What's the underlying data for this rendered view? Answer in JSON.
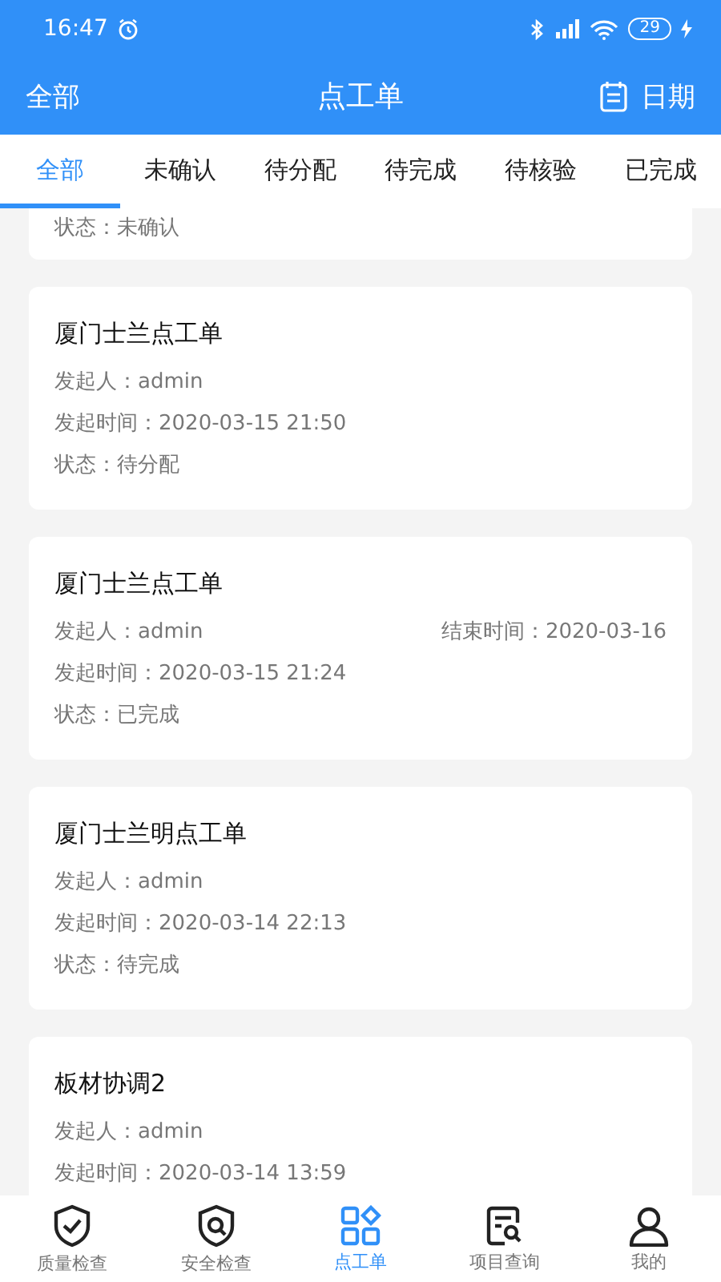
{
  "status_bar": {
    "time": "16:47",
    "battery": "29"
  },
  "header": {
    "left": "全部",
    "title": "点工单",
    "right": "日期"
  },
  "tabs": [
    {
      "label": "全部",
      "selected": true
    },
    {
      "label": "未确认",
      "selected": false
    },
    {
      "label": "待分配",
      "selected": false
    },
    {
      "label": "待完成",
      "selected": false
    },
    {
      "label": "待核验",
      "selected": false
    },
    {
      "label": "已完成",
      "selected": false
    }
  ],
  "orders": [
    {
      "status": "状态：未确认"
    },
    {
      "title": "厦门士兰点工单",
      "initiator": "发起人：admin",
      "time": "发起时间：2020-03-15 21:50",
      "status": "状态：待分配"
    },
    {
      "title": "厦门士兰点工单",
      "initiator": "发起人：admin",
      "end_time": "结束时间：2020-03-16",
      "time": "发起时间：2020-03-15 21:24",
      "status": "状态：已完成"
    },
    {
      "title": "厦门士兰明点工单",
      "initiator": "发起人：admin",
      "time": "发起时间：2020-03-14 22:13",
      "status": "状态：待完成"
    },
    {
      "title": "板材协调2",
      "initiator": "发起人：admin",
      "time": "发起时间：2020-03-14 13:59"
    }
  ],
  "nav": [
    {
      "label": "质量检查",
      "selected": false
    },
    {
      "label": "安全检查",
      "selected": false
    },
    {
      "label": "点工单",
      "selected": true
    },
    {
      "label": "项目查询",
      "selected": false
    },
    {
      "label": "我的",
      "selected": false
    }
  ]
}
